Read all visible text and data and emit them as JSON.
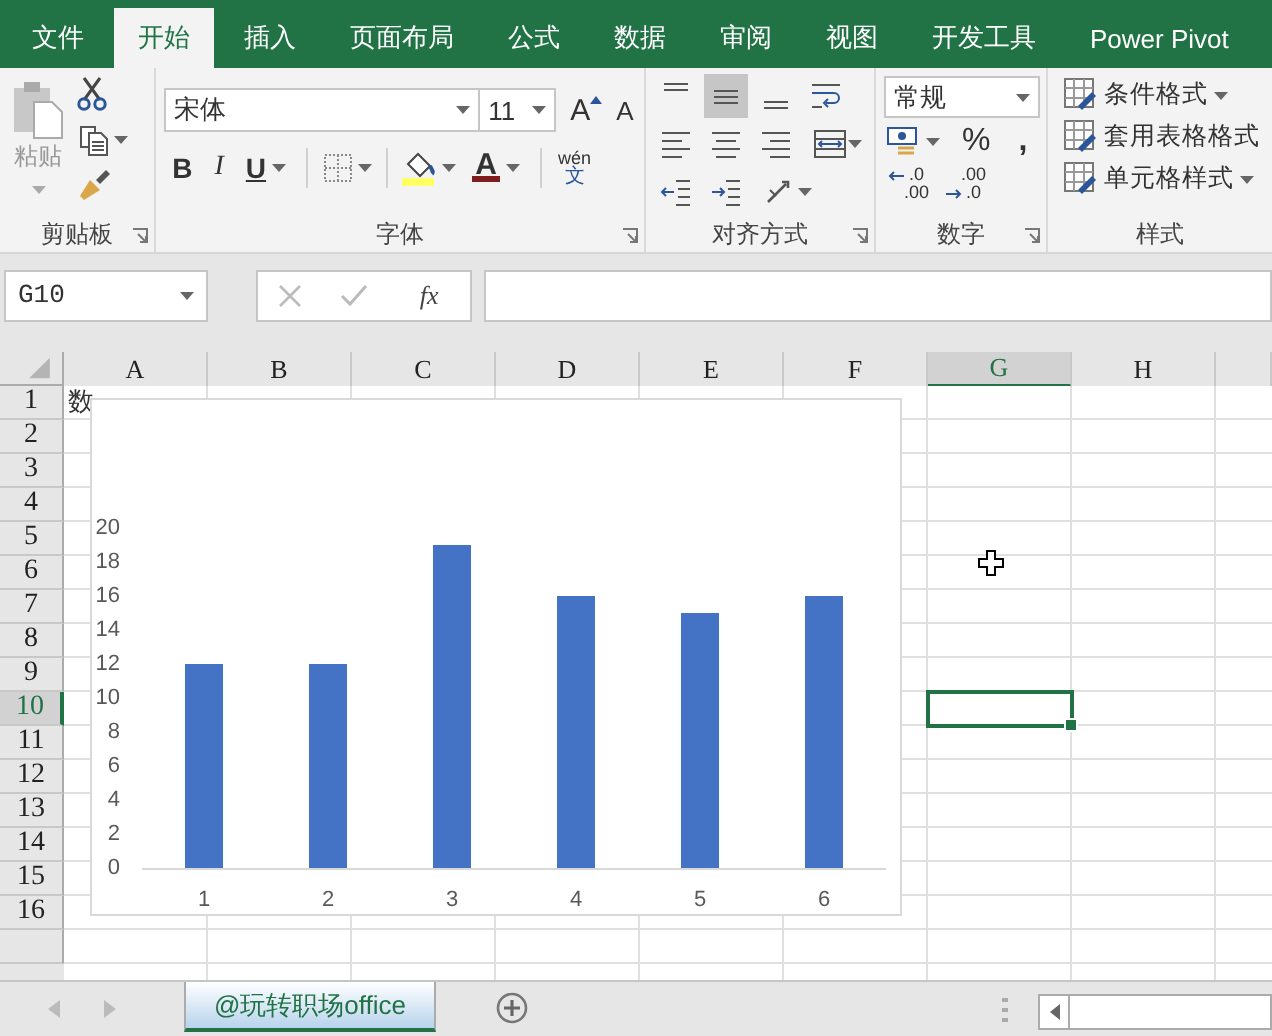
{
  "tabs": [
    {
      "label": "文件",
      "selected": false
    },
    {
      "label": "开始",
      "selected": true
    },
    {
      "label": "插入",
      "selected": false
    },
    {
      "label": "页面布局",
      "selected": false
    },
    {
      "label": "公式",
      "selected": false
    },
    {
      "label": "数据",
      "selected": false
    },
    {
      "label": "审阅",
      "selected": false
    },
    {
      "label": "视图",
      "selected": false
    },
    {
      "label": "开发工具",
      "selected": false
    },
    {
      "label": "Power Pivot",
      "selected": false
    }
  ],
  "clipboard": {
    "paste": {
      "label": "粘贴",
      "disabled": true
    },
    "group_label": "剪贴板"
  },
  "font": {
    "font_name": "宋体",
    "font_size": "11",
    "grow": "A",
    "shrink": "A",
    "bold": "B",
    "italic": "I",
    "underline": "U",
    "font_color": "A",
    "phonetic_top": "wén",
    "phonetic_bottom": "文",
    "group_label": "字体"
  },
  "alignment": {
    "buttons": [
      {
        "kind": "top",
        "selected": false
      },
      {
        "kind": "middle",
        "selected": true
      },
      {
        "kind": "bottom",
        "selected": false
      },
      {
        "kind": "wrap",
        "selected": false
      },
      {
        "kind": "left",
        "selected": false
      },
      {
        "kind": "center",
        "selected": false
      },
      {
        "kind": "right",
        "selected": false
      },
      {
        "kind": "merge",
        "selected": false
      },
      {
        "kind": "outdent",
        "selected": false
      },
      {
        "kind": "indent",
        "selected": false
      },
      {
        "kind": "orientation",
        "selected": false
      }
    ],
    "group_label": "对齐方式"
  },
  "number": {
    "format": "常规",
    "percent": "%",
    "comma": ",",
    "decimals": [
      {
        "top": ".0",
        "bottom": ".00"
      },
      {
        "top": ".00",
        "bottom": ".0"
      }
    ],
    "group_label": "数字"
  },
  "styles": {
    "items": [
      {
        "label": "条件格式",
        "dropdown": true
      },
      {
        "label": "套用表格格式",
        "dropdown": false
      },
      {
        "label": "单元格样式",
        "dropdown": true
      }
    ],
    "group_label": "样式"
  },
  "formula_bar": {
    "name_box": "G10",
    "fx": "fx"
  },
  "sheet": {
    "columns": [
      {
        "label": "A",
        "selected": false
      },
      {
        "label": "B",
        "selected": false
      },
      {
        "label": "C",
        "selected": false
      },
      {
        "label": "D",
        "selected": false
      },
      {
        "label": "E",
        "selected": false
      },
      {
        "label": "F",
        "selected": false
      },
      {
        "label": "G",
        "selected": true
      },
      {
        "label": "H",
        "selected": false
      }
    ],
    "rows": [
      {
        "label": "1",
        "selected": false
      },
      {
        "label": "2",
        "selected": false
      },
      {
        "label": "3",
        "selected": false
      },
      {
        "label": "4",
        "selected": false
      },
      {
        "label": "5",
        "selected": false
      },
      {
        "label": "6",
        "selected": false
      },
      {
        "label": "7",
        "selected": false
      },
      {
        "label": "8",
        "selected": false
      },
      {
        "label": "9",
        "selected": false
      },
      {
        "label": "10",
        "selected": true
      },
      {
        "label": "11",
        "selected": false
      },
      {
        "label": "12",
        "selected": false
      },
      {
        "label": "13",
        "selected": false
      },
      {
        "label": "14",
        "selected": false
      },
      {
        "label": "15",
        "selected": false
      },
      {
        "label": "16",
        "selected": false
      }
    ],
    "a1_text": "数"
  },
  "chart": {
    "chart_data": {
      "type": "bar",
      "categories": [
        "1",
        "2",
        "3",
        "4",
        "5",
        "6"
      ],
      "series": [
        {
          "color": "#4472c4",
          "values": [
            12,
            12,
            19,
            16,
            15,
            16
          ]
        }
      ],
      "ylim": [
        0,
        20
      ],
      "yticks": [
        0,
        2,
        4,
        6,
        8,
        10,
        12,
        14,
        16,
        18,
        20
      ]
    }
  },
  "sheet_tabs": [
    {
      "label": "@玩转职场office",
      "selected": true
    }
  ]
}
